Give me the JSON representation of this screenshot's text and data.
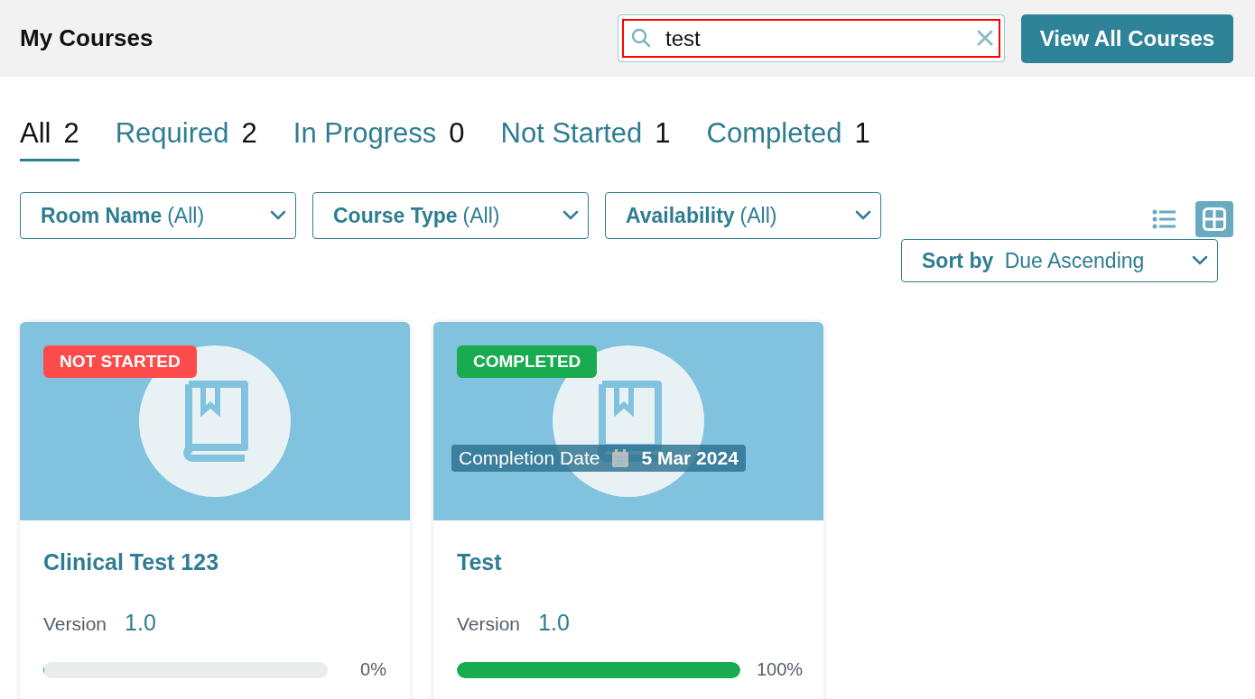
{
  "header": {
    "title": "My Courses",
    "search": {
      "value": "test",
      "focused": true
    },
    "button": "View All Courses"
  },
  "tabs": [
    {
      "label": "All",
      "count": "2",
      "selected": true
    },
    {
      "label": "Required",
      "count": "2",
      "selected": false
    },
    {
      "label": "In Progress",
      "count": "0",
      "selected": false
    },
    {
      "label": "Not Started",
      "count": "1",
      "selected": false
    },
    {
      "label": "Completed",
      "count": "1",
      "selected": false
    }
  ],
  "filters": [
    {
      "label": "Room Name",
      "value": "(All)"
    },
    {
      "label": "Course Type",
      "value": "(All)"
    },
    {
      "label": "Availability",
      "value": "(All)"
    }
  ],
  "view_toggle": [
    {
      "kind": "list",
      "selected": false
    },
    {
      "kind": "grid",
      "selected": true
    }
  ],
  "sort": {
    "label": "Sort by",
    "value": "Due Ascending"
  },
  "courses": [
    {
      "status": "NOT STARTED",
      "color": "#fd4b4b",
      "title": "Clinical Test 123",
      "version_label": "Version",
      "version": "1.0",
      "level": 0,
      "percent": "0%"
    },
    {
      "status": "COMPLETED",
      "color": "#18ab4f",
      "completion_label": "Completion Date",
      "completion_date": "5 Mar 2024",
      "title": "Test",
      "version_label": "Version",
      "version": "1.0",
      "level": 1,
      "percent": "100%"
    }
  ]
}
